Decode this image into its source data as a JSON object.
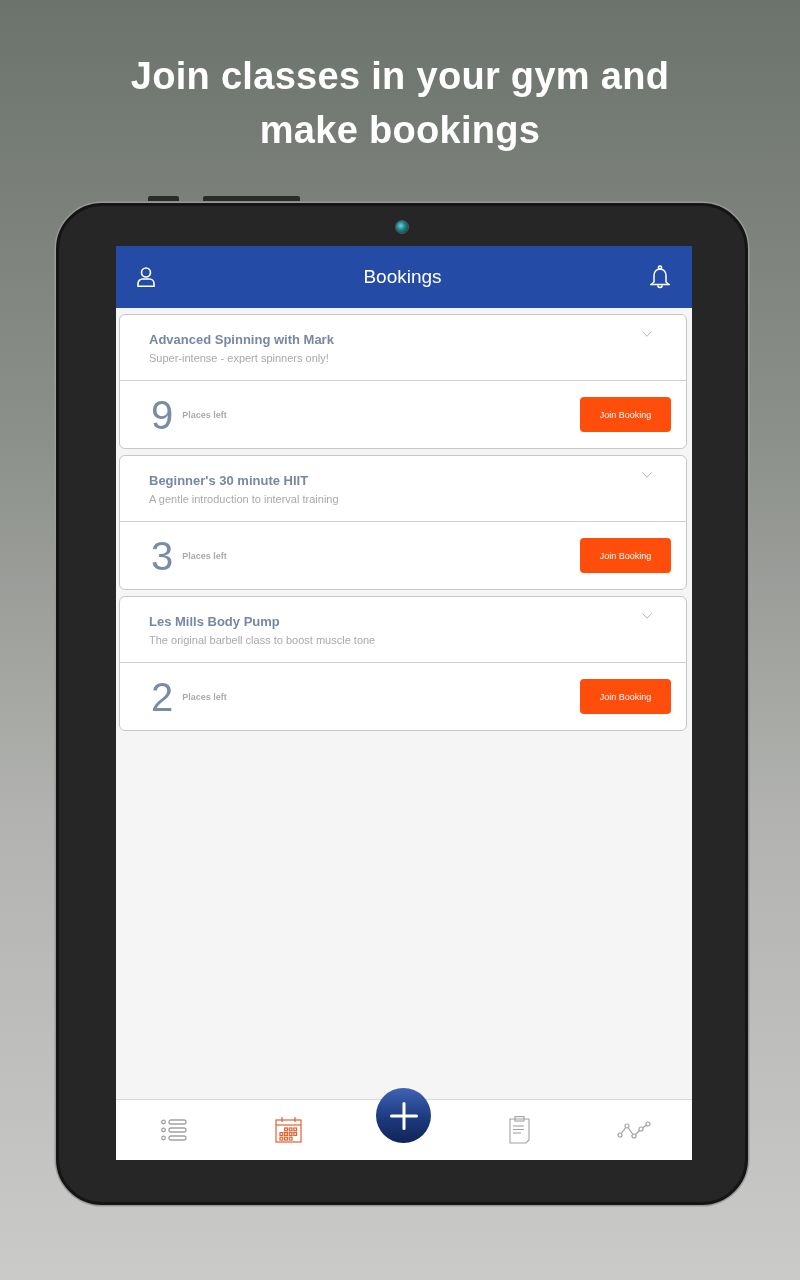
{
  "headline": "Join classes in your gym and make bookings",
  "app_bar": {
    "title": "Bookings"
  },
  "bookings": [
    {
      "title": "Advanced Spinning with Mark",
      "description": "Super-intense - expert spinners only!",
      "places": "9",
      "places_label": "Places left",
      "button": "Join Booking",
      "expanded": false
    },
    {
      "title": "Beginner's 30 minute HIIT",
      "description": "A gentle introduction to interval training",
      "places": "3",
      "places_label": "Places left",
      "button": "Join Booking",
      "expanded": false
    },
    {
      "title": "Les Mills Body Pump",
      "description": "The original barbell class to boost muscle tone",
      "places": "2",
      "places_label": "Places left",
      "button": "Join Booking",
      "expanded": false
    }
  ],
  "bottom_nav": [
    {
      "kind": "list",
      "selected": false
    },
    {
      "kind": "calendar",
      "selected": true
    },
    {
      "kind": "add",
      "selected": false
    },
    {
      "kind": "clipboard",
      "selected": false
    },
    {
      "kind": "chart",
      "selected": false
    }
  ]
}
